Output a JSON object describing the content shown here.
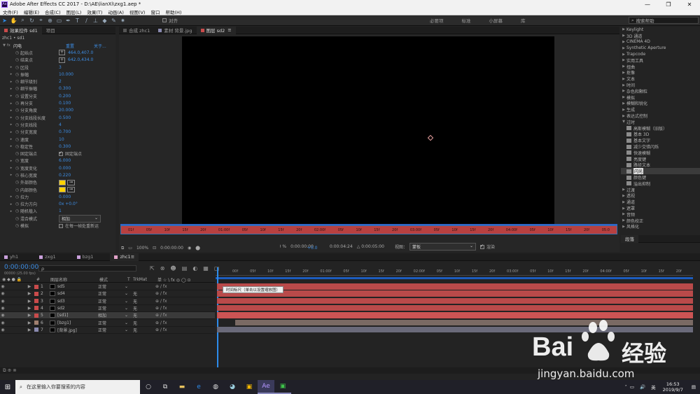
{
  "window": {
    "title": "Adobe After Effects CC 2017 - D:\\AE\\lianXi\\zxg1.aep *",
    "logo": "Ae"
  },
  "menu": [
    "文件(F)",
    "编辑(E)",
    "合成(C)",
    "图层(L)",
    "效果(T)",
    "动画(A)",
    "视图(V)",
    "窗口",
    "帮助(H)"
  ],
  "toolbar": {
    "snap_label": "对齐",
    "workspaces": [
      "必要项",
      "标准",
      "小屏幕",
      "库"
    ],
    "search_placeholder": "搜索帮助"
  },
  "effect_panel": {
    "tabs": [
      "效果控件 sd1",
      "项目"
    ],
    "breadcrumb": "zhc1 • sd1",
    "effect_name": "闪电",
    "reset": "重置",
    "about": "关于...",
    "rows": [
      {
        "name": "起始点",
        "type": "point",
        "value": "464.0,407.0"
      },
      {
        "name": "结束点",
        "type": "point",
        "value": "642.0,434.0"
      },
      {
        "name": "区段",
        "value": "3"
      },
      {
        "name": "振幅",
        "value": "10.000"
      },
      {
        "name": "细节级别",
        "value": "2"
      },
      {
        "name": "细节振幅",
        "value": "0.300"
      },
      {
        "name": "设置分支",
        "value": "0.200"
      },
      {
        "name": "再分支",
        "value": "0.100"
      },
      {
        "name": "分支角度",
        "value": "20.000"
      },
      {
        "name": "分支线段长度",
        "value": "0.500"
      },
      {
        "name": "分支线段",
        "value": "4"
      },
      {
        "name": "分支宽度",
        "value": "0.700"
      },
      {
        "name": "速度",
        "value": "10"
      },
      {
        "name": "稳定性",
        "value": "0.300"
      },
      {
        "name": "固定端点",
        "type": "checkbox",
        "value": "固定端点",
        "checked": true
      },
      {
        "name": "宽度",
        "value": "6.000"
      },
      {
        "name": "宽度变化",
        "value": "0.000"
      },
      {
        "name": "核心宽度",
        "value": "0.220"
      },
      {
        "name": "外部颜色",
        "type": "color"
      },
      {
        "name": "内部颜色",
        "type": "color"
      },
      {
        "name": "拉力",
        "value": "0.000"
      },
      {
        "name": "拉力方向",
        "value": "0x +0.0°"
      },
      {
        "name": "随机植入",
        "value": "1"
      },
      {
        "name": "混合模式",
        "type": "dropdown",
        "value": "相加"
      },
      {
        "name": "模拟",
        "type": "checkbox",
        "value": "在每一帧处重新运",
        "checked": false
      }
    ],
    "colors": {
      "outer": "#ffd200",
      "inner": "#ffd200"
    }
  },
  "comp_panel": {
    "tabs": [
      "合成 zhc1",
      "素材 背景.jpg",
      "图层 sd2"
    ],
    "ruler_labels": [
      "01f",
      "05f",
      "10f",
      "15f",
      "20f",
      "01:00f",
      "05f",
      "10f",
      "15f",
      "20f",
      "02:00f",
      "05f",
      "10f",
      "15f",
      "20f",
      "03:00f",
      "05f",
      "10f",
      "15f",
      "20f",
      "04:00f",
      "05f",
      "10f",
      "15f",
      "20f",
      "05:0"
    ],
    "viewer_zoom": "100%",
    "viewer_time": "0:00:00:00",
    "controls": {
      "duration_in": "0:00:00:00",
      "duration_out": "0:00:04:24",
      "duration_total": "△ 0:00:05:00",
      "view_label": "视图：",
      "view_value": "蒙板",
      "render_label": "渲染",
      "exposure": "+0.0",
      "resolution": "100 %"
    }
  },
  "effects_presets": {
    "items": [
      {
        "label": "Keylight",
        "level": 0,
        "expanded": false
      },
      {
        "label": "3D 通道",
        "level": 0,
        "expanded": false
      },
      {
        "label": "CINEMA 4D",
        "level": 0,
        "expanded": false
      },
      {
        "label": "Synthetic Aperture",
        "level": 0,
        "expanded": false
      },
      {
        "label": "Trapcode",
        "level": 0,
        "expanded": false
      },
      {
        "label": "实用工具",
        "level": 0,
        "expanded": false
      },
      {
        "label": "扭曲",
        "level": 0,
        "expanded": false
      },
      {
        "label": "抠像",
        "level": 0,
        "expanded": false
      },
      {
        "label": "文本",
        "level": 0,
        "expanded": false
      },
      {
        "label": "时间",
        "level": 0,
        "expanded": false
      },
      {
        "label": "杂色和颗粒",
        "level": 0,
        "expanded": false
      },
      {
        "label": "模拟",
        "level": 0,
        "expanded": false
      },
      {
        "label": "模糊和锐化",
        "level": 0,
        "expanded": false
      },
      {
        "label": "生成",
        "level": 0,
        "expanded": false
      },
      {
        "label": "表达式控制",
        "level": 0,
        "expanded": false
      },
      {
        "label": "过时",
        "level": 0,
        "expanded": true
      },
      {
        "label": "高斯模糊（旧版）",
        "level": 1
      },
      {
        "label": "基本 3D",
        "level": 1
      },
      {
        "label": "基本文字",
        "level": 1
      },
      {
        "label": "减少交错闪烁",
        "level": 1
      },
      {
        "label": "快速模糊",
        "level": 1
      },
      {
        "label": "亮度键",
        "level": 1
      },
      {
        "label": "路径文本",
        "level": 1
      },
      {
        "label": "闪光",
        "level": 1,
        "selected": true
      },
      {
        "label": "颜色键",
        "level": 1
      },
      {
        "label": "溢出抑制",
        "level": 1
      },
      {
        "label": "过渡",
        "level": 0,
        "expanded": false
      },
      {
        "label": "透视",
        "level": 0,
        "expanded": false
      },
      {
        "label": "通道",
        "level": 0,
        "expanded": false
      },
      {
        "label": "遮罩",
        "level": 0,
        "expanded": false
      },
      {
        "label": "音频",
        "level": 0,
        "expanded": false
      },
      {
        "label": "颜色校正",
        "level": 0,
        "expanded": false
      },
      {
        "label": "风格化",
        "level": 0,
        "expanded": false
      }
    ],
    "paragraph_tab": "段落"
  },
  "timeline": {
    "tabs": [
      {
        "label": "yh1",
        "color": "#c9a0dc"
      },
      {
        "label": "zxg1",
        "color": "#c9a0dc"
      },
      {
        "label": "bzg1",
        "color": "#c9a0dc"
      },
      {
        "label": "zhc1",
        "color": "#e2a2c8",
        "active": true
      }
    ],
    "timecode": "0:00:00:00",
    "fps": "00000 (25.00 fps)",
    "search_placeholder": "ρ",
    "headers": {
      "num": "#",
      "name": "图层名称",
      "mode": "模式",
      "t": "T",
      "trkmat": "TrkMat",
      "switches": "单 ☆ \\ fx ◎ ◯ ⊙"
    },
    "ruler_labels": [
      "00f",
      "05f",
      "10f",
      "15f",
      "20f",
      "01:00f",
      "05f",
      "10f",
      "15f",
      "20f",
      "02:00f",
      "05f",
      "10f",
      "15f",
      "20f",
      "03:00f",
      "05f",
      "10f",
      "15f",
      "20f",
      "04:00f",
      "05f",
      "10f",
      "15f",
      "20f"
    ],
    "tooltip": "时间标尺（单击以设置缩放图）",
    "layers": [
      {
        "num": "1",
        "name": "sd5",
        "mode": "正常",
        "trkmat": "",
        "label_color": "#c94b4b",
        "bar": "#b94a4a"
      },
      {
        "num": "2",
        "name": "sd4",
        "mode": "正常",
        "trkmat": "无",
        "label_color": "#c94b4b",
        "bar": "#b94a4a"
      },
      {
        "num": "3",
        "name": "sd3",
        "mode": "正常",
        "trkmat": "无",
        "label_color": "#c94b4b",
        "bar": "#b94a4a"
      },
      {
        "num": "4",
        "name": "sd2",
        "mode": "正常",
        "trkmat": "无",
        "label_color": "#c94b4b",
        "bar": "#b94a4a"
      },
      {
        "num": "5",
        "name": "[sd1]",
        "mode": "相加",
        "trkmat": "无",
        "label_color": "#c94b4b",
        "bar": "#cc5454",
        "selected": true
      },
      {
        "num": "6",
        "name": "[bzg1]",
        "mode": "正常",
        "trkmat": "无",
        "label_color": "#a08070",
        "bar": "#7a6a64"
      },
      {
        "num": "7",
        "name": "[背景.jpg]",
        "mode": "正常",
        "trkmat": "无",
        "label_color": "#8a8ab0",
        "bar": "#6a6a7a"
      }
    ]
  },
  "taskbar": {
    "search_placeholder": "在这里输入你要搜索的内容",
    "clock_time": "16:53",
    "clock_date": "2019/9/7",
    "ime": "英"
  },
  "watermark": {
    "brand": "Bai",
    "cn": "经验",
    "url": "jingyan.baidu.com"
  }
}
